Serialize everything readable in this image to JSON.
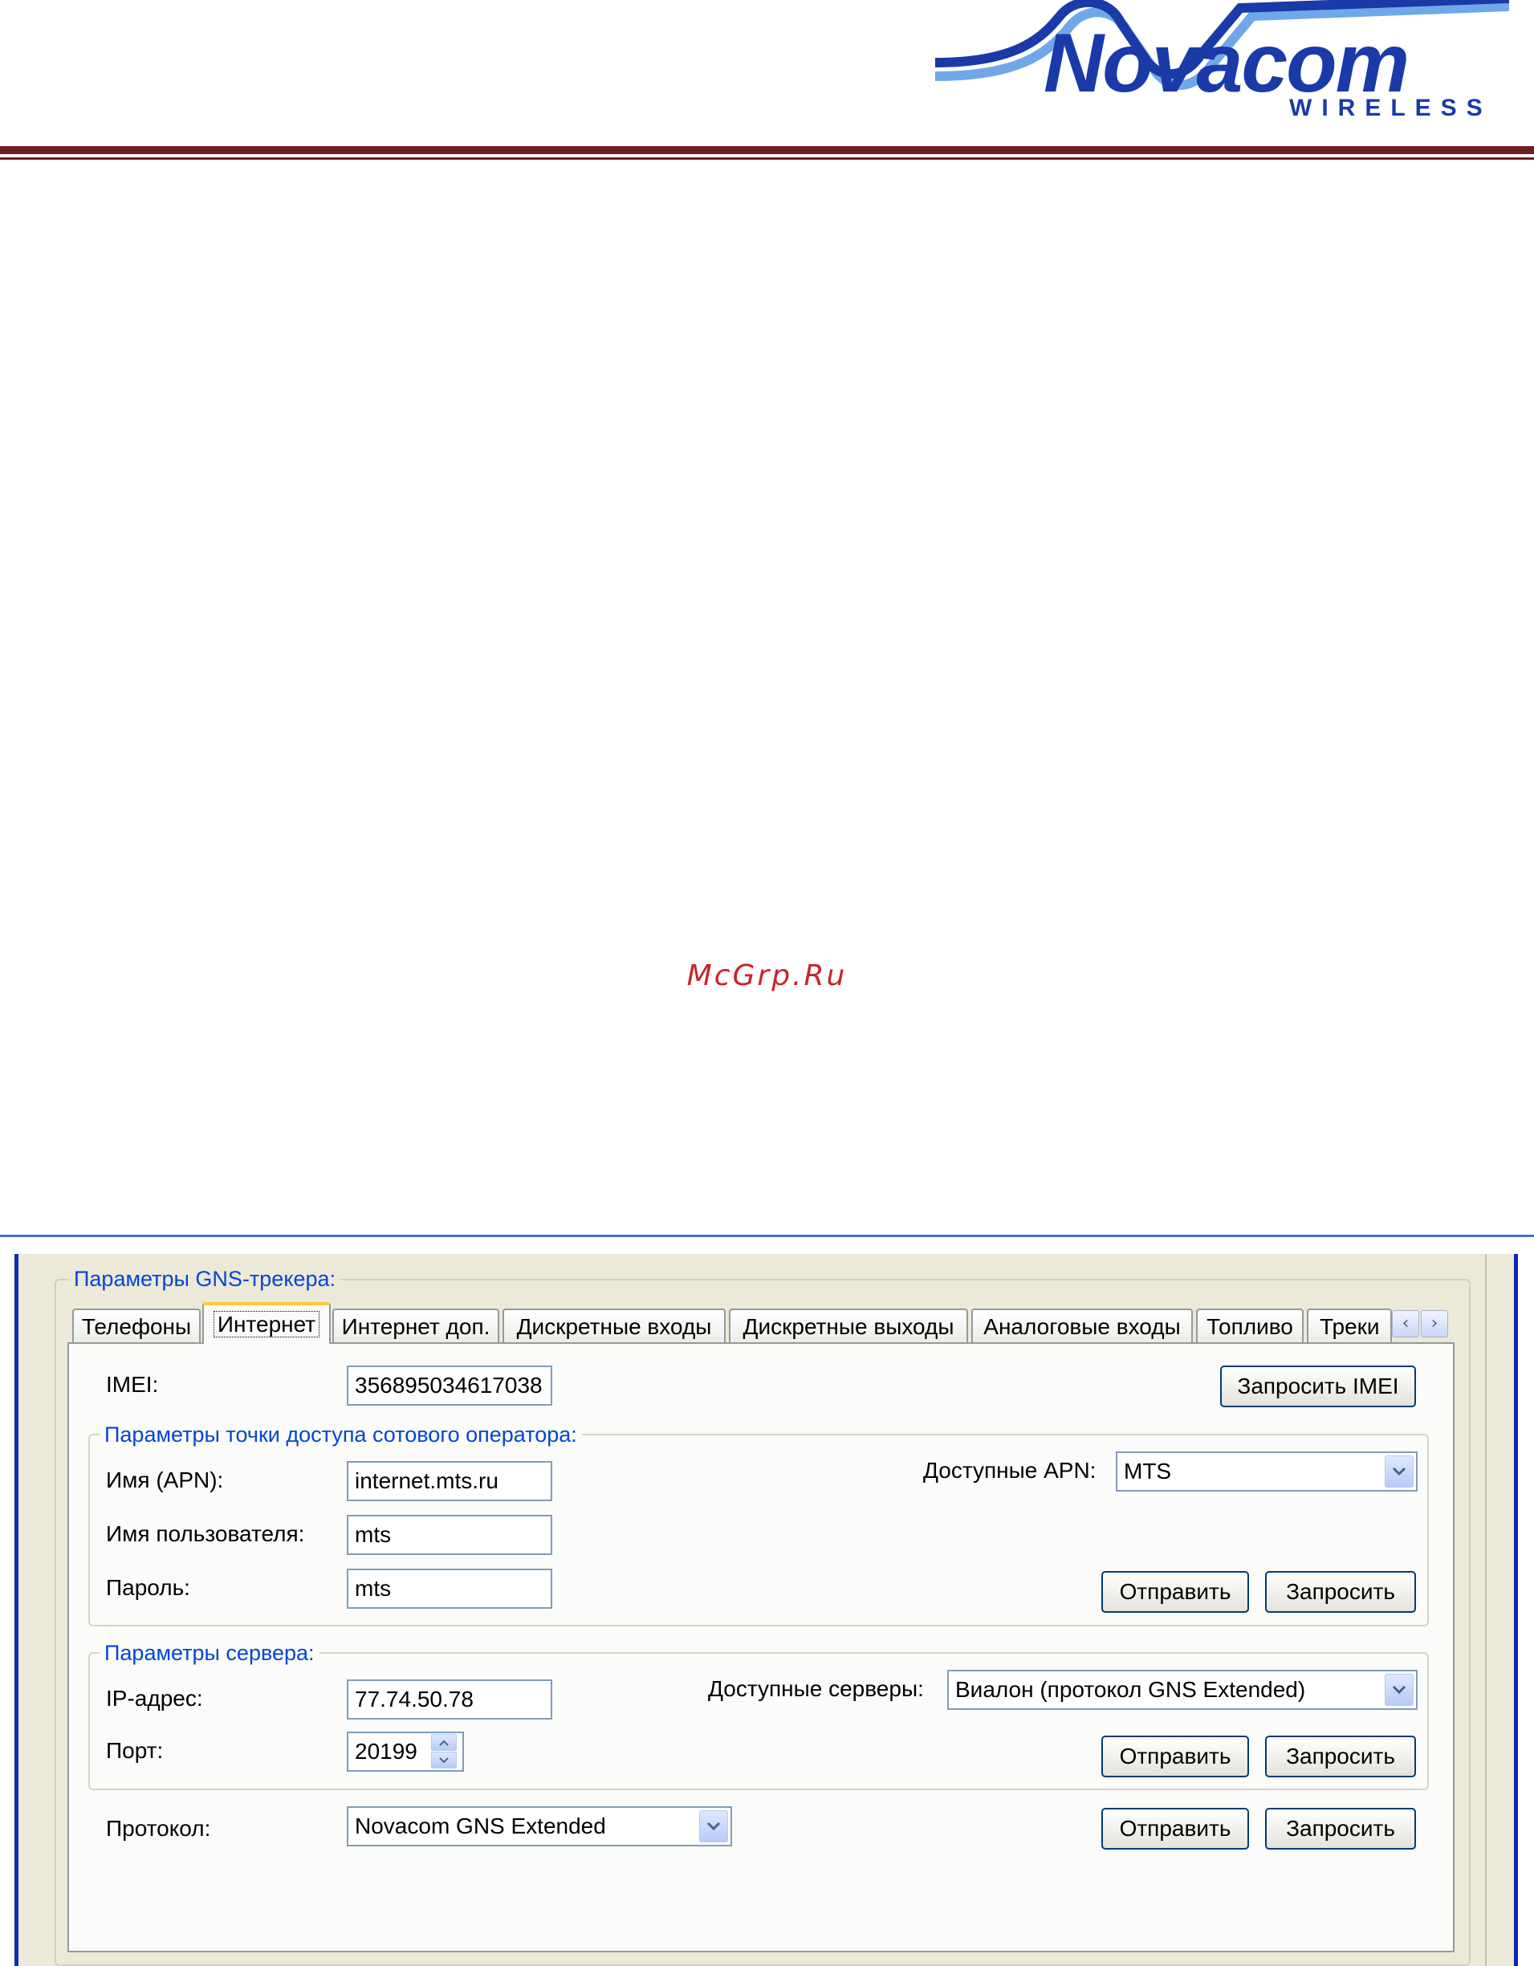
{
  "header": {
    "logo": {
      "brand": "Novacom",
      "sub": "WIRELESS"
    },
    "colors": {
      "rule": "#6b1f22",
      "logo_dark": "#1a3aa8",
      "logo_light": "#6fa8e8"
    }
  },
  "watermark": "McGrp.Ru",
  "window": {
    "group_title": "Параметры GNS-трекера:",
    "tabs": [
      {
        "label": "Телефоны",
        "active": false
      },
      {
        "label": "Интернет",
        "active": true
      },
      {
        "label": "Интернет доп.",
        "active": false
      },
      {
        "label": "Дискретные входы",
        "active": false
      },
      {
        "label": "Дискретные выходы",
        "active": false
      },
      {
        "label": "Аналоговые входы",
        "active": false
      },
      {
        "label": "Топливо",
        "active": false
      },
      {
        "label": "Треки",
        "active": false
      }
    ],
    "tab_scroll": {
      "left_icon": "chevron-left-icon",
      "right_icon": "chevron-right-icon"
    },
    "imei": {
      "label": "IMEI:",
      "value": "356895034617038",
      "request_button": "Запросить IMEI"
    },
    "apn_group": {
      "title": "Параметры точки доступа сотового оператора:",
      "apn_label": "Имя (APN):",
      "apn_value": "internet.mts.ru",
      "user_label": "Имя пользователя:",
      "user_value": "mts",
      "password_label": "Пароль:",
      "password_value": "mts",
      "available_label": "Доступные APN:",
      "available_value": "MTS",
      "send_button": "Отправить",
      "request_button": "Запросить"
    },
    "server_group": {
      "title": "Параметры сервера:",
      "ip_label": "IP-адрес:",
      "ip_value": "77.74.50.78",
      "port_label": "Порт:",
      "port_value": "20199",
      "available_label": "Доступные серверы:",
      "available_value": "Виалон (протокол GNS Extended)",
      "send_button": "Отправить",
      "request_button": "Запросить"
    },
    "protocol": {
      "label": "Протокол:",
      "value": "Novacom GNS Extended",
      "send_button": "Отправить",
      "request_button": "Запросить"
    }
  }
}
